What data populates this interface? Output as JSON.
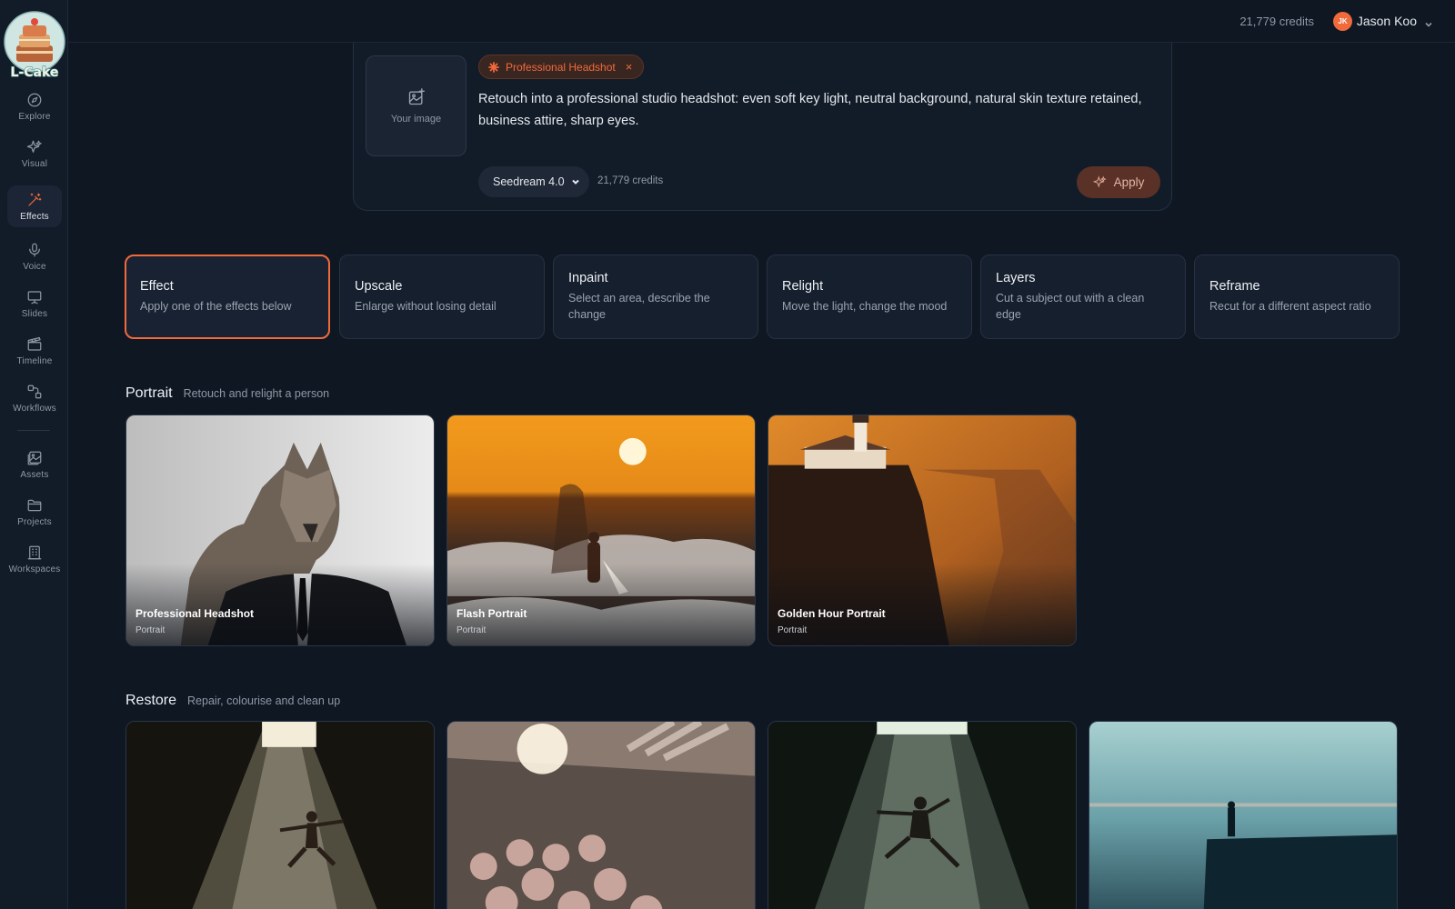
{
  "sidebar": {
    "logo_text": "L-Cake",
    "items": [
      {
        "label": "Explore",
        "icon": "compass-icon"
      },
      {
        "label": "Visual",
        "icon": "sparkles-icon"
      },
      {
        "label": "Effects",
        "icon": "magic-wand-icon",
        "active": true
      },
      {
        "label": "Voice",
        "icon": "microphone-icon"
      },
      {
        "label": "Slides",
        "icon": "presentation-icon"
      },
      {
        "label": "Timeline",
        "icon": "clapperboard-icon"
      },
      {
        "label": "Workflows",
        "icon": "workflow-icon"
      },
      {
        "label": "Assets",
        "icon": "image-stack-icon"
      },
      {
        "label": "Projects",
        "icon": "folder-icon"
      },
      {
        "label": "Workspaces",
        "icon": "building-icon"
      }
    ]
  },
  "topbar": {
    "credits": "21,779 credits",
    "user_initials": "JK",
    "user_name": "Jason Koo"
  },
  "prompt": {
    "upload_label": "Your image",
    "chip_label": "Professional Headshot",
    "chip_close": "×",
    "text": "Retouch into a professional studio headshot: even soft key light, neutral background, natural skin texture retained, business attire, sharp eyes.",
    "model": "Seedream 4.0",
    "credits": "21,779 credits",
    "apply_label": "Apply"
  },
  "tools": [
    {
      "title": "Effect",
      "desc": "Apply one of the effects below",
      "active": true
    },
    {
      "title": "Upscale",
      "desc": "Enlarge without losing detail"
    },
    {
      "title": "Inpaint",
      "desc": "Select an area, describe the change"
    },
    {
      "title": "Relight",
      "desc": "Move the light, change the mood"
    },
    {
      "title": "Layers",
      "desc": "Cut a subject out with a clean edge"
    },
    {
      "title": "Reframe",
      "desc": "Recut for a different aspect ratio"
    }
  ],
  "sections": [
    {
      "title": "Portrait",
      "subtitle": "Retouch and relight a person",
      "cards": [
        {
          "title": "Professional Headshot",
          "category": "Portrait"
        },
        {
          "title": "Flash Portrait",
          "category": "Portrait"
        },
        {
          "title": "Golden Hour Portrait",
          "category": "Portrait"
        }
      ]
    },
    {
      "title": "Restore",
      "subtitle": "Repair, colourise and clean up",
      "cards": [
        {},
        {},
        {},
        {}
      ]
    }
  ],
  "colors": {
    "accent": "#f06a3c",
    "background": "#0f1723",
    "sidebar": "#121b28",
    "card": "#151f2d"
  }
}
